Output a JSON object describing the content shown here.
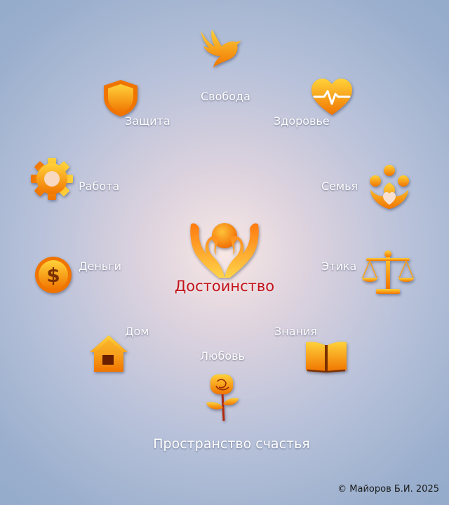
{
  "center": {
    "label": "Достоинство"
  },
  "nodes": {
    "freedom": "Свобода",
    "health": "Здоровье",
    "protection": "Защита",
    "family": "Семья",
    "work": "Работа",
    "ethics": "Этика",
    "money": "Деньги",
    "home": "Дом",
    "knowledge": "Знания",
    "love": "Любовь"
  },
  "footer": {
    "title": "Пространство счастья",
    "copyright": "©  Майоров Б.И.  2025"
  },
  "icons": {
    "freedom": "dove-icon",
    "health": "heart-pulse-icon",
    "protection": "shield-icon",
    "family": "family-icon",
    "work": "gear-icon",
    "ethics": "scales-icon",
    "money": "dollar-coin-icon",
    "home": "house-icon",
    "knowledge": "open-book-icon",
    "love": "rose-icon",
    "center": "hands-sun-icon"
  },
  "colors": {
    "icon_light": "#ffd23a",
    "icon_dark": "#f07400",
    "center_text": "#c3131a",
    "background": "#9aafcd"
  }
}
